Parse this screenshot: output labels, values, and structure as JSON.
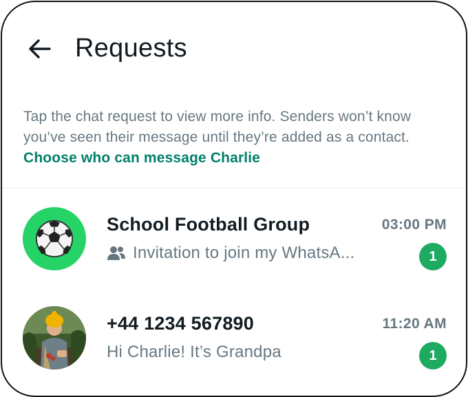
{
  "header": {
    "title": "Requests",
    "back_icon": "arrow-left-icon"
  },
  "info": {
    "text": "Tap the chat request to view more info. Senders won’t know you’ve seen their message until they’re added as a contact.",
    "link_label": "Choose who can message Charlie"
  },
  "colors": {
    "accent": "#008069",
    "badge": "#1daa61",
    "group_avatar_bg": "#25d366",
    "text_primary": "#111b21",
    "text_secondary": "#667781"
  },
  "requests": [
    {
      "name": "School Football Group",
      "time": "03:00 PM",
      "preview": "Invitation to join my WhatsA...",
      "preview_icon": "group-icon",
      "avatar_icon": "soccer-ball-icon",
      "unread": "1"
    },
    {
      "name": "+44 1234 567890",
      "time": "11:20 AM",
      "preview": "Hi Charlie! It’s Grandpa",
      "avatar_icon": "person-photo-avatar",
      "unread": "1"
    }
  ]
}
